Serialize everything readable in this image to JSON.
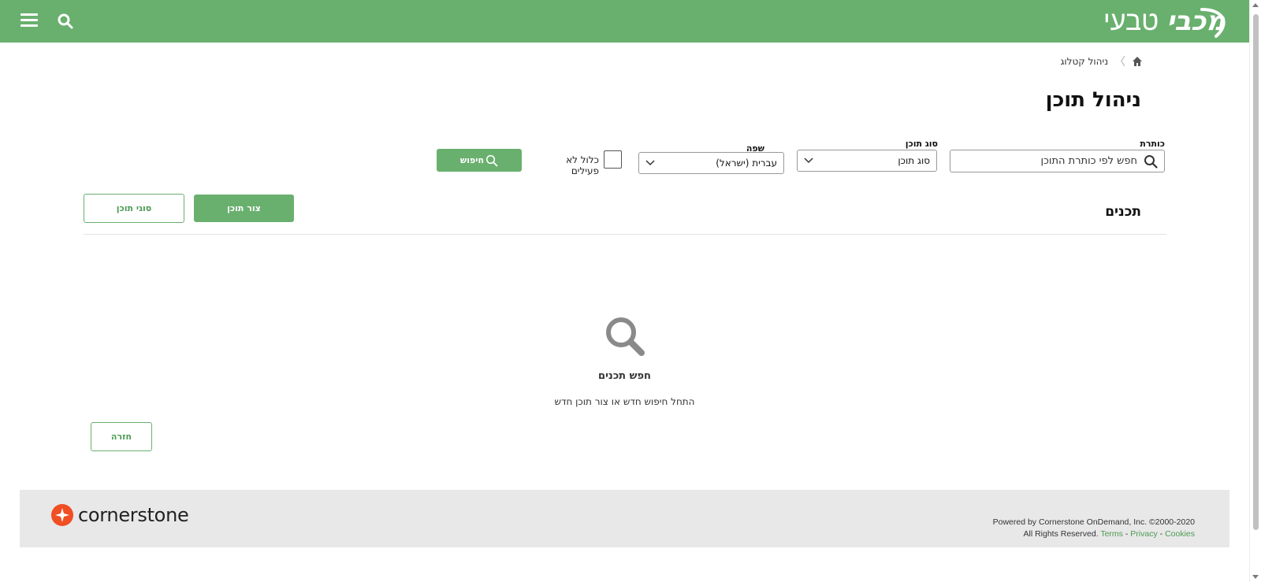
{
  "header": {
    "logo_bold": "מכבי",
    "logo_light": "טבעי"
  },
  "breadcrumb": {
    "current": "ניהול קטלוג"
  },
  "page_title": "ניהול תוכן",
  "filters": {
    "title_label": "כותרת",
    "title_placeholder": "חפש לפי כותרת התוכן",
    "type_label": "סוג תוכן",
    "type_value": "סוג תוכן",
    "language_label": "שפה",
    "language_value": "עברית (ישראל)",
    "include_inactive_label": "כלול לא פעילים",
    "search_button": "חיפוש"
  },
  "contents": {
    "section_title": "תכנים",
    "create_button": "צור תוכן",
    "types_button": "סוגי תוכן"
  },
  "empty_state": {
    "title": "חפש תכנים",
    "subtitle": "התחל חיפוש חדש או צור תוכן חדש"
  },
  "back_button": "חזרה",
  "footer": {
    "brand": "cornerstone",
    "powered_by": "Powered by Cornerstone OnDemand, Inc. ©2000-2020",
    "rights": "All Rights Reserved.",
    "terms": "Terms",
    "privacy": "Privacy",
    "cookies": "Cookies",
    "sep": "-"
  },
  "colors": {
    "brand_green": "#69b06e",
    "cornerstone_orange": "#f04e23"
  }
}
